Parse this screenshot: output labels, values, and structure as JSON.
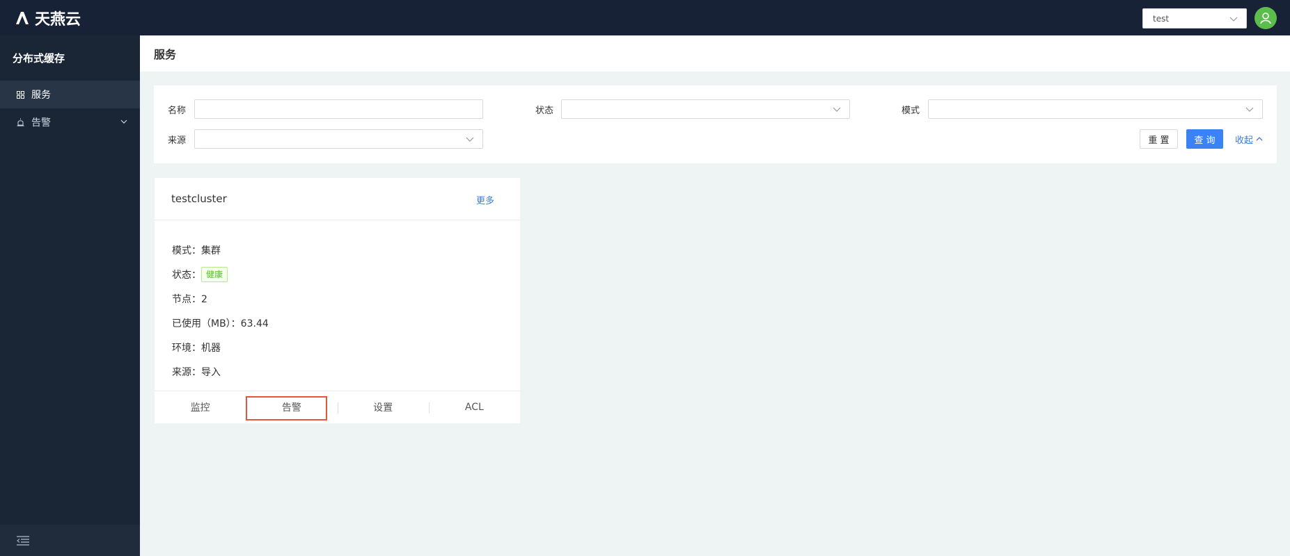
{
  "brand": {
    "name": "天燕云"
  },
  "topbar": {
    "tenant_value": "test"
  },
  "sidebar": {
    "title": "分布式缓存",
    "items": [
      {
        "label": "服务",
        "icon": "grid-icon",
        "active": true
      },
      {
        "label": "告警",
        "icon": "alarm-icon",
        "active": false
      }
    ]
  },
  "page": {
    "title": "服务"
  },
  "filters": {
    "name_label": "名称",
    "status_label": "状态",
    "mode_label": "模式",
    "source_label": "来源",
    "reset_label": "重 置",
    "query_label": "查 询",
    "collapse_label": "收起"
  },
  "card": {
    "title": "testcluster",
    "more_label": "更多",
    "mode": "模式：集群",
    "status_label": "状态：",
    "status_tag": "健康",
    "nodes": "节点：2",
    "used": "已使用（MB）：63.44",
    "env": "环境：机器",
    "source": "来源：导入",
    "actions": [
      "监控",
      "告警",
      "设置",
      "ACL"
    ]
  },
  "colors": {
    "primary": "#3b82f6",
    "header_bg": "#172236",
    "sidebar_bg": "#1a2535",
    "success": "#52c41a",
    "highlight": "#e8553e"
  }
}
